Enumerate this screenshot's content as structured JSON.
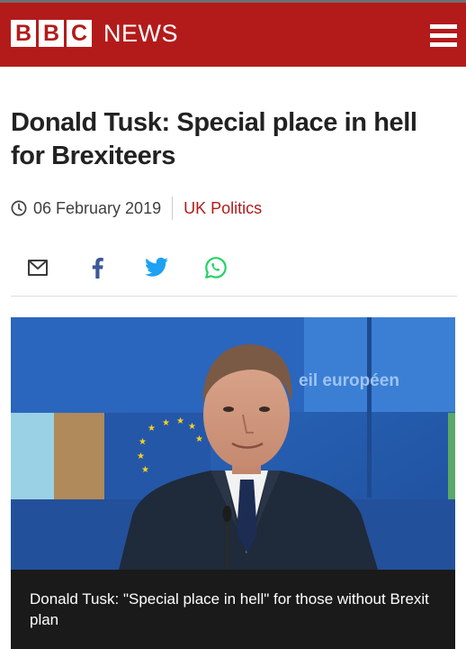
{
  "header": {
    "brand_letters": [
      "B",
      "B",
      "C"
    ],
    "brand_word": "NEWS",
    "brand_color": "#b31b1b",
    "menu_icon": "hamburger-menu-icon"
  },
  "article": {
    "headline": "Donald Tusk: Special place in hell for Brexiteers",
    "date": "06 February 2019",
    "section": "UK Politics",
    "clock_icon": "clock-icon"
  },
  "share": {
    "icons": [
      "email-icon",
      "facebook-icon",
      "twitter-icon",
      "whatsapp-icon"
    ]
  },
  "media": {
    "backdrop_text": "eil européen",
    "caption": "Donald Tusk: \"Special place in hell\" for those without Brexit plan"
  }
}
